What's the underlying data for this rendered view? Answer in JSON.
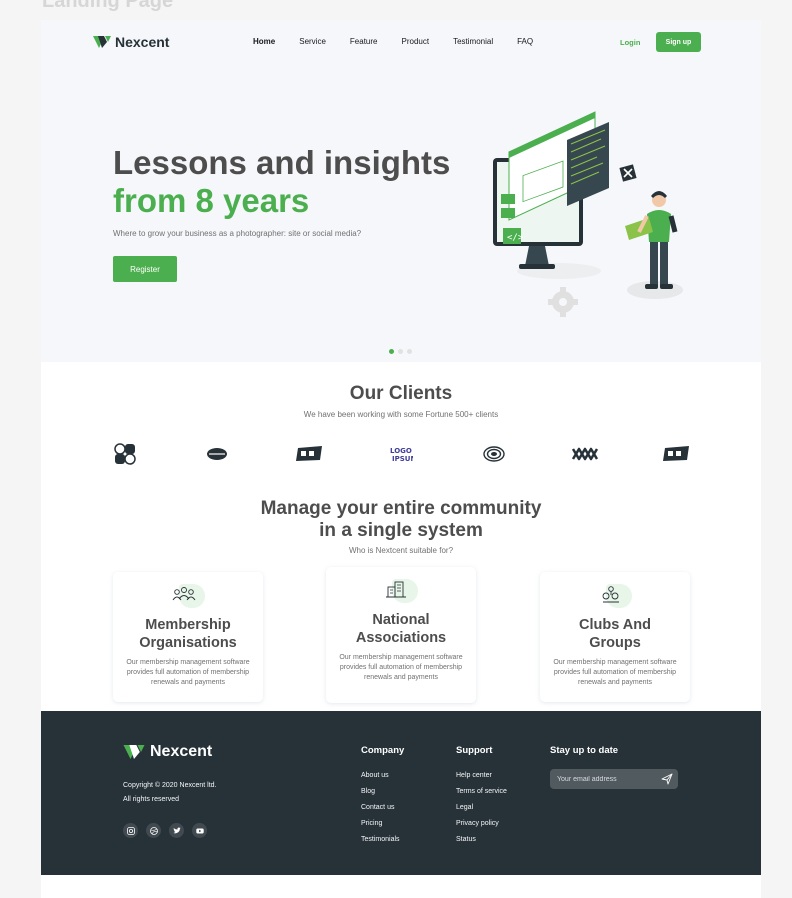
{
  "canvas": {
    "title": "Landing Page"
  },
  "brand": {
    "name": "Nexcent"
  },
  "colors": {
    "primary": "#4caf4f",
    "dark": "#263238",
    "text": "#4d4d4d",
    "muted": "#717171",
    "hero_bg": "#f5f7fa"
  },
  "nav": {
    "items": [
      "Home",
      "Service",
      "Feature",
      "Product",
      "Testimonial",
      "FAQ"
    ],
    "active": "Home",
    "login": "Login",
    "signup": "Sign up"
  },
  "hero": {
    "title_line1": "Lessons and insights",
    "title_line2": "from 8 years",
    "subtitle": "Where to grow your business as a photographer: site or social media?",
    "cta": "Register",
    "slides": 3,
    "active_slide": 1
  },
  "clients": {
    "title": "Our Clients",
    "subtitle": "We have been working with some Fortune 500+ clients",
    "logos": [
      "client-logo-1",
      "client-logo-2",
      "client-logo-3",
      "client-logo-4",
      "client-logo-5",
      "client-logo-6",
      "client-logo-7"
    ]
  },
  "community": {
    "title_line1": "Manage your entire community",
    "title_line2": "in a single system",
    "subtitle": "Who is Nextcent suitable for?",
    "cards": [
      {
        "icon": "people-group-icon",
        "title_line1": "Membership",
        "title_line2": "Organisations",
        "text": "Our membership management software provides full automation of membership renewals and payments"
      },
      {
        "icon": "buildings-icon",
        "title_line1": "National",
        "title_line2": "Associations",
        "text": "Our membership management software provides full automation of membership renewals and payments"
      },
      {
        "icon": "hand-heart-icon",
        "title_line1": "Clubs And",
        "title_line2": "Groups",
        "text": "Our membership management software provides full automation of membership renewals and payments"
      }
    ]
  },
  "footer": {
    "copyright_line1": "Copyright © 2020 Nexcent ltd.",
    "copyright_line2": "All rights reserved",
    "socials": [
      "instagram-icon",
      "dribbble-icon",
      "twitter-icon",
      "youtube-icon"
    ],
    "company": {
      "title": "Company",
      "links": [
        "About us",
        "Blog",
        "Contact us",
        "Pricing",
        "Testimonials"
      ]
    },
    "support": {
      "title": "Support",
      "links": [
        "Help center",
        "Terms of service",
        "Legal",
        "Privacy policy",
        "Status"
      ]
    },
    "newsletter": {
      "title": "Stay up to date",
      "placeholder": "Your email address"
    }
  }
}
